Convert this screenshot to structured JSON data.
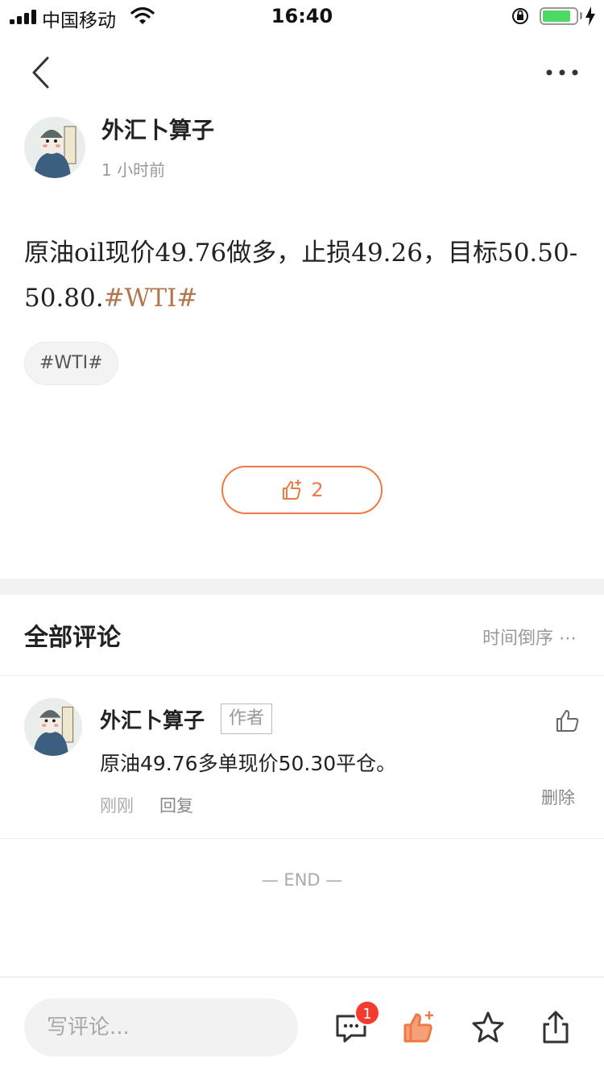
{
  "status_bar": {
    "carrier": "中国移动",
    "time": "16:40",
    "battery_level": 0.85
  },
  "nav": {
    "back_icon": "chevron-left-icon",
    "more_icon": "more-dots-icon"
  },
  "post": {
    "author": "外汇卜算子",
    "time": "1 小时前",
    "text": "原油oil现价49.76做多，止损49.26，目标50.50-50.80.",
    "hashtag_inline": "#WTI#",
    "tag_chip": "#WTI#",
    "like_count": "2"
  },
  "comments": {
    "title": "全部评论",
    "sort_label": "时间倒序",
    "sort_icon": "ellipsis-icon",
    "items": [
      {
        "author": "外汇卜算子",
        "badge": "作者",
        "text": "原油49.76多单现价50.30平仓。",
        "time": "刚刚",
        "reply_label": "回复",
        "delete_label": "删除"
      }
    ],
    "end_text": "— END —"
  },
  "bottom_bar": {
    "input_placeholder": "写评论...",
    "comment_badge": "1"
  },
  "colors": {
    "accent": "#ec7a45",
    "hashtag": "#b3774f",
    "badge": "#f53b30"
  }
}
